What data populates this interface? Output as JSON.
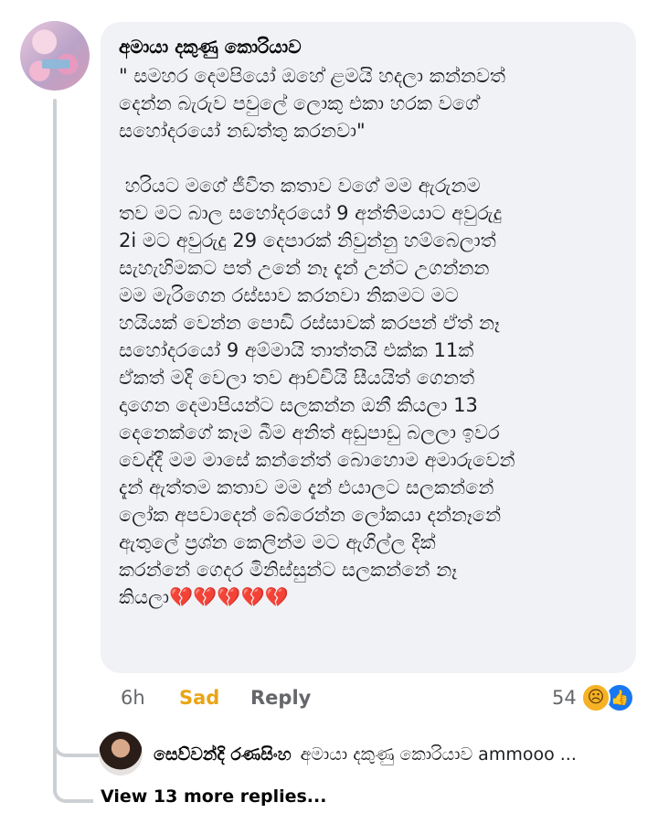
{
  "comment": {
    "author": "අමායා දකුණු කොරියාව",
    "body": "\" සමහර දෙමපියෝ ඔහේ ළමයි හදලා කන්නවත්\nදෙන්න බැරුව පවුලේ ලොකු එකා හරක වගේ\nසහෝදරයෝ නඩත්තු කරනවා\"\n\n හරියට මගේ ජීවිත කතාව වගේ මම ඇරුනම\nතව මට බාල සහෝදරයෝ 9 අන්තිමයාට අවුරුදු\n2i මට අවුරුදු 29 දෙපාරක් නිවුන්නු හම්බෙලාත්\nසැහැහිමකට පත් උනේ නෑ දැන් උන්ට උගන්නන\nමම මැරිගෙන රස්සාව කරනවා නිකමට මට\nහයියක් වෙන්න පොඩි රස්සාවක් කරපන් ඒත් නෑ\nසහෝදරයෝ 9 අම්මායි තාත්තයි එක්ක 11ක්\nඒකත් මදි වෙලා තව ආච්චියි සීයයිත් ගෙනත්\nදාගෙන දෙමාපියන්ට සලකන්න ඔනී කියලා 13\nදෙනෙක්ගේ කෑම බීම අනිත් අඩුපාඩු බලලා ඉවර\nවෙද්දී මම මාසේ කන්නේත් බොහොම අමාරුවෙන්\nදැන් ඇත්තම කතාව මම දැන් එයාලට සලකන්නේ\nලෝක අපවාදෙන් බේරෙන්න ලෝකයා දන්නෑනේ\nඇතුලේ ප්‍රශ්න කෙලින්ම මට ඇගිල්ල දික්\nකරන්නේ ගෙදර මිනිස්සුන්ට සලකන්නේ නෑ\nකියලා",
    "hearts": "💔💔💔💔💔",
    "time": "6h",
    "reaction_label": "Sad",
    "reply_label": "Reply",
    "reaction_count": "54",
    "reaction_icons": [
      "sad-emoji-icon",
      "like-thumb-icon"
    ]
  },
  "reply_preview": {
    "author": "සෙව්වන්දි රණසිංහ",
    "text": "අමායා දකුණු කොරියාව ammooo ..."
  },
  "view_more": "View 13 more replies...",
  "colors": {
    "bubble": "#f0f2f5",
    "sad_reaction": "#e9a516",
    "like_blue": "#1877f2",
    "muted": "#65676b"
  }
}
